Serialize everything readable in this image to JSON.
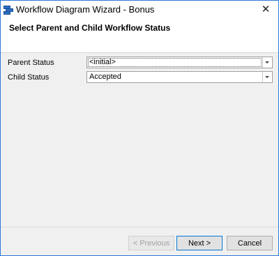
{
  "window": {
    "title": "Workflow Diagram Wizard - Bonus",
    "close_glyph": "✕"
  },
  "header": {
    "title": "Select Parent and Child Workflow Status"
  },
  "form": {
    "parent_status": {
      "label": "Parent Status",
      "value": "<initial>"
    },
    "child_status": {
      "label": "Child Status",
      "value": "Accepted"
    }
  },
  "footer": {
    "previous_label": "< Previous",
    "next_label": "Next >",
    "cancel_label": "Cancel"
  },
  "colors": {
    "accent": "#0078d7",
    "window_border": "#2b79d8",
    "body_bg": "#f0f0f0"
  },
  "icons": [
    "workflow-app-icon",
    "close-icon",
    "dropdown-arrow-icon"
  ]
}
